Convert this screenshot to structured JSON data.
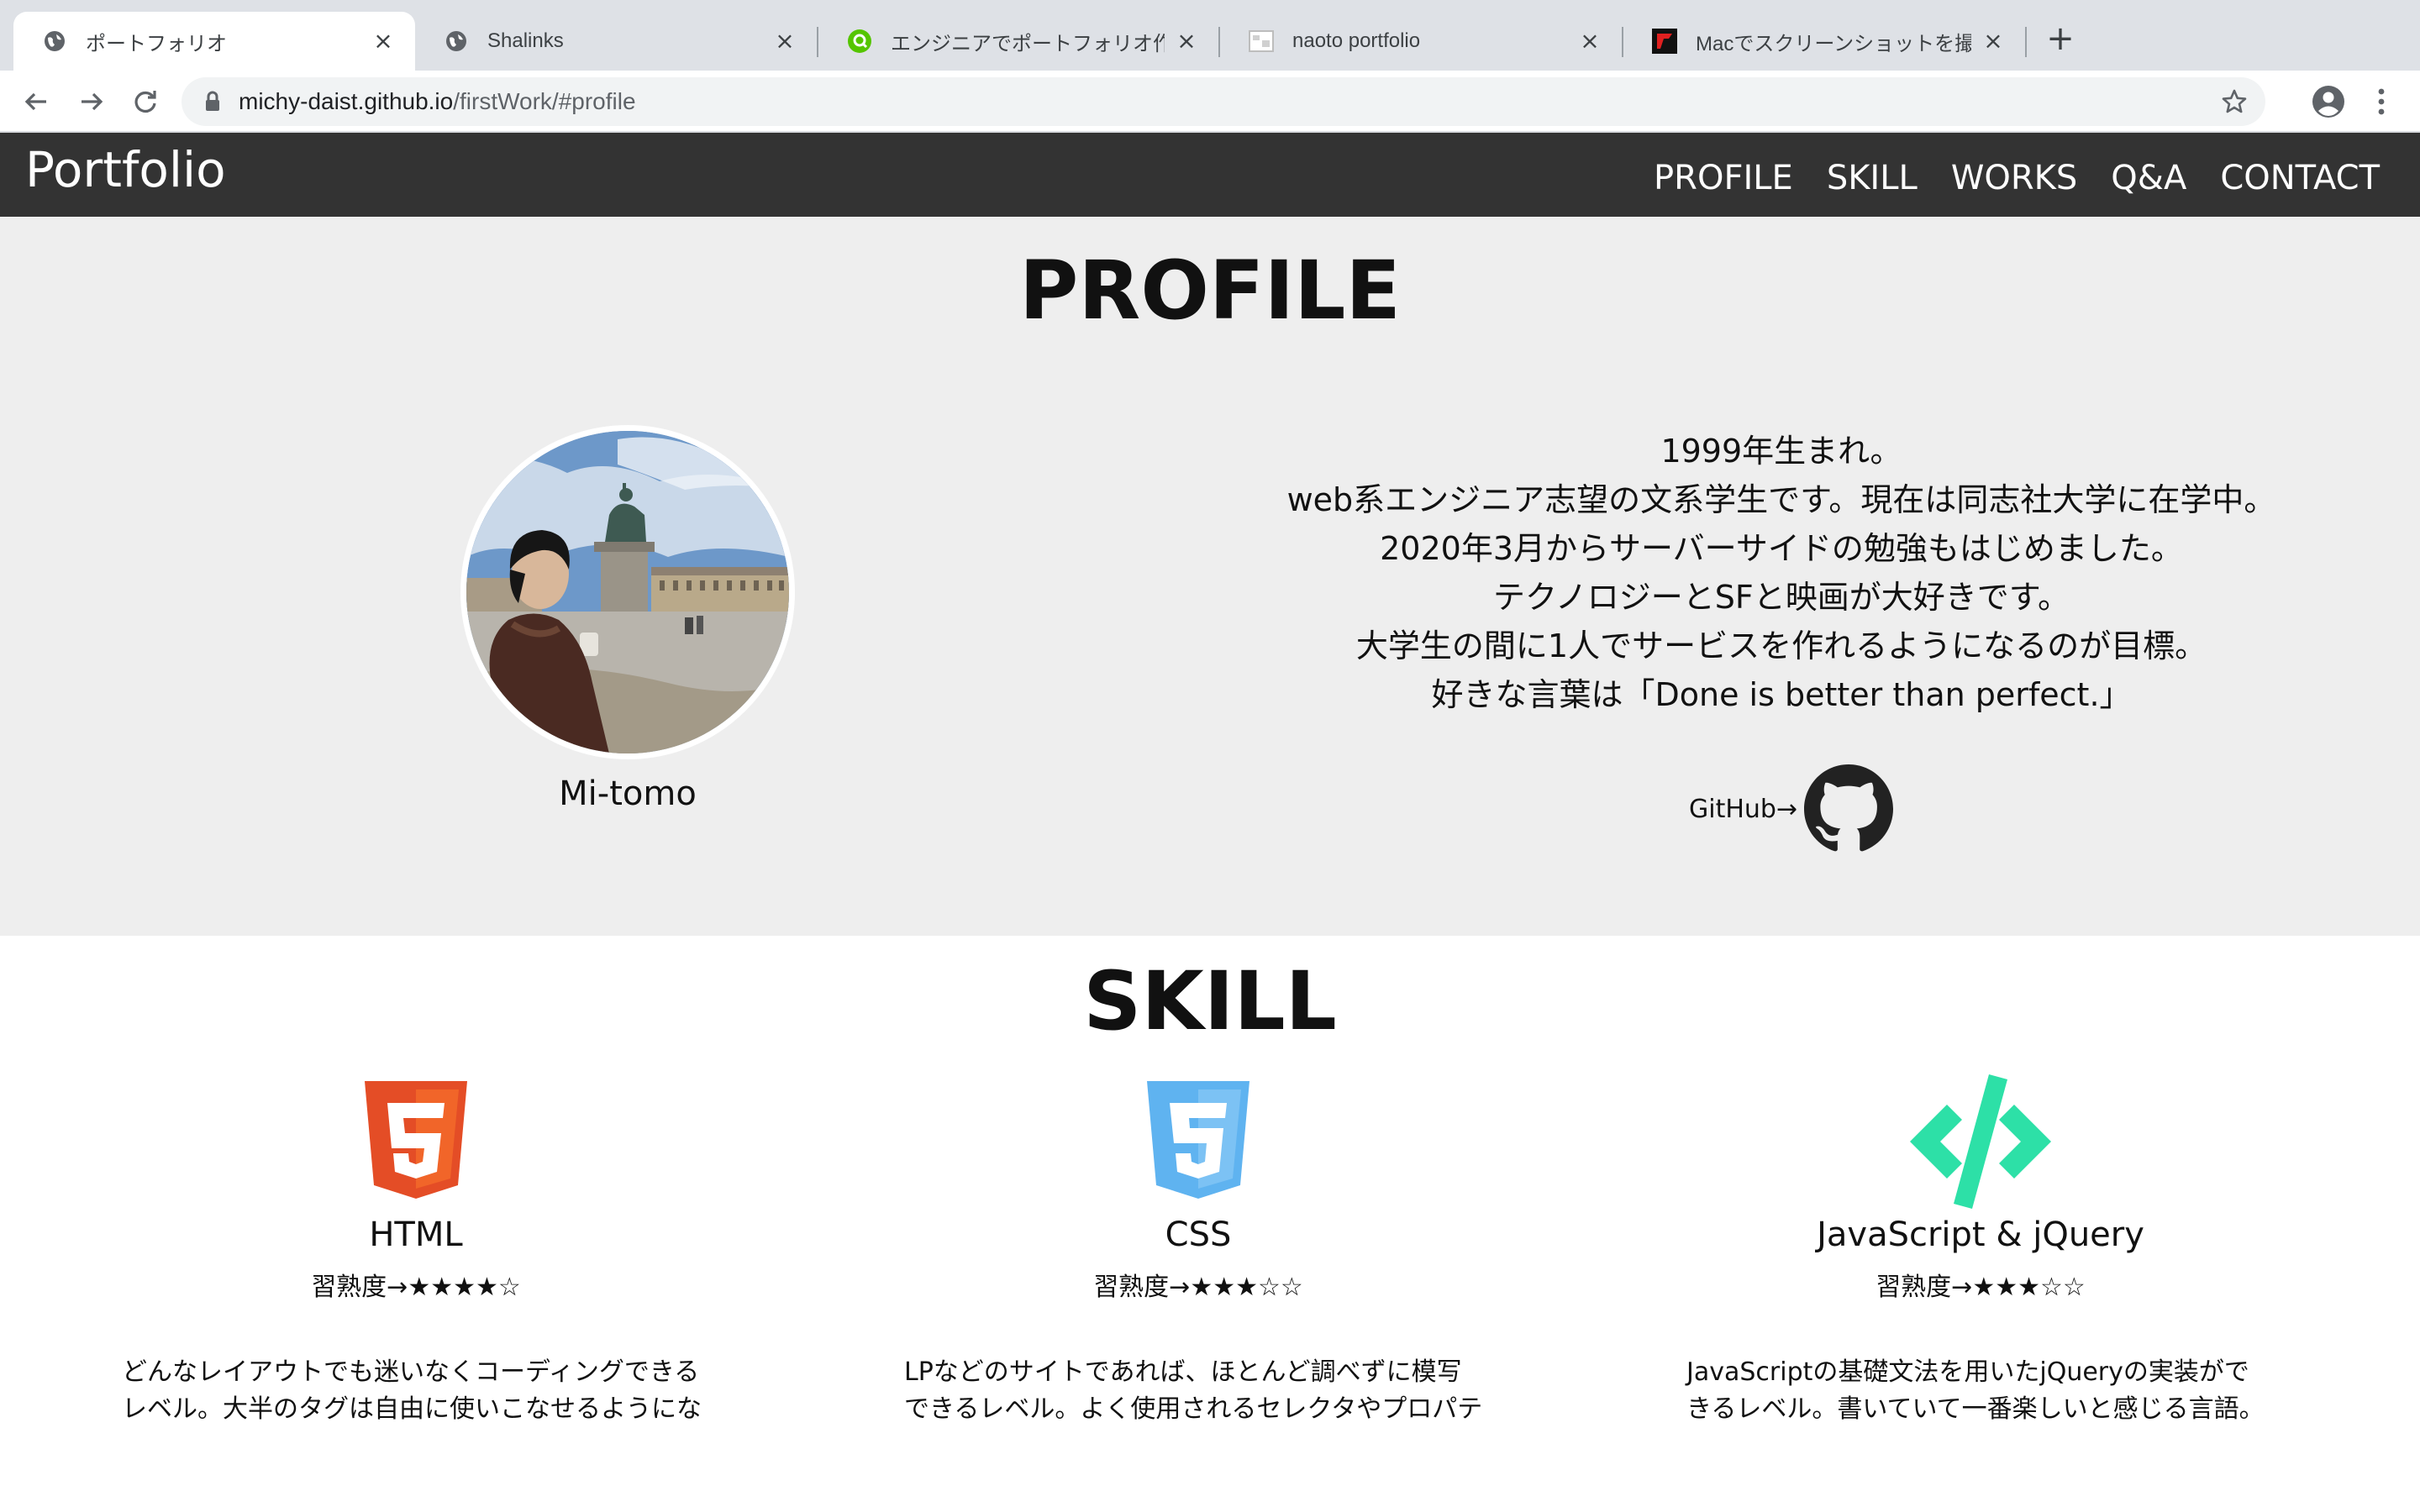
{
  "browser": {
    "tabs": [
      {
        "title": "ポートフォリオ",
        "favicon": "globe-icon",
        "active": true
      },
      {
        "title": "Shalinks",
        "favicon": "globe-icon",
        "active": false
      },
      {
        "title": "エンジニアでポートフォリオ作りま",
        "favicon": "qiita-search-icon",
        "active": false
      },
      {
        "title": "naoto portfolio",
        "favicon": "image-icon",
        "active": false
      },
      {
        "title": "Macでスクリーンショットを撮る方",
        "favicon": "red-square-icon",
        "active": false
      }
    ],
    "close_glyph": "×",
    "new_tab_glyph": "+",
    "url": {
      "host": "michy-daist.github.io",
      "path": "/firstWork/#profile"
    }
  },
  "site": {
    "logo": "Portfolio",
    "nav": [
      "PROFILE",
      "SKILL",
      "WORKS",
      "Q&A",
      "CONTACT"
    ]
  },
  "profile": {
    "title": "PROFILE",
    "name": "Mi-tomo",
    "bio": [
      "1999年生まれ。",
      "web系エンジニア志望の文系学生です。現在は同志社大学に在学中。",
      "2020年3月からサーバーサイドの勉強もはじめました。",
      "テクノロジーとSFと映画が大好きです。",
      "大学生の間に1人でサービスを作れるようになるのが目標。",
      "好きな言葉は「Done is better than perfect.」"
    ],
    "github_label": "GitHub→"
  },
  "skill": {
    "title": "SKILL",
    "cards": [
      {
        "name": "HTML",
        "icon": "html5-icon",
        "level": "習熟度→★★★★☆",
        "desc": [
          "どんなレイアウトでも迷いなくコーディングできる",
          "レベル。大半のタグは自由に使いこなせるようにな"
        ]
      },
      {
        "name": "CSS",
        "icon": "css3-icon",
        "level": "習熟度→★★★☆☆",
        "desc": [
          "LPなどのサイトであれば、ほとんど調べずに模写",
          "できるレベル。よく使用されるセレクタやプロパテ"
        ]
      },
      {
        "name": "JavaScript & jQuery",
        "icon": "code-icon",
        "level": "習熟度→★★★☆☆",
        "desc": [
          "JavaScriptの基礎文法を用いたjQueryの実装がで",
          "きるレベル。書いていて一番楽しいと感じる言語。"
        ]
      }
    ]
  },
  "colors": {
    "header_bg": "#333333",
    "profile_bg": "#eeeeee",
    "html5_orange": "#e44d26",
    "css3_blue": "#5fb3f0",
    "js_green": "#2de0a7"
  }
}
